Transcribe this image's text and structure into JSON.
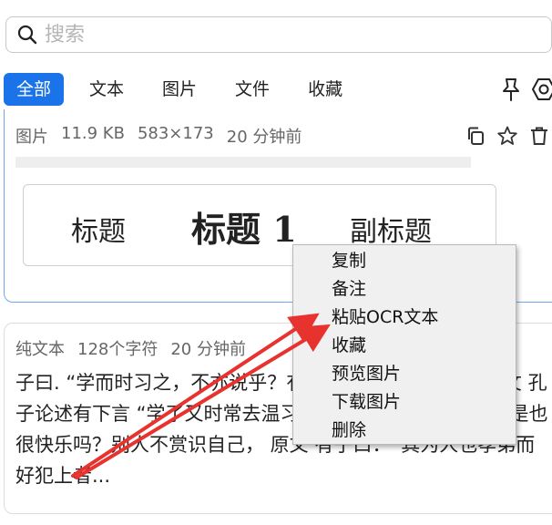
{
  "search": {
    "placeholder": "搜索"
  },
  "tabs": [
    {
      "label": "全部",
      "active": true
    },
    {
      "label": "文本"
    },
    {
      "label": "图片"
    },
    {
      "label": "文件"
    },
    {
      "label": "收藏"
    }
  ],
  "cards": [
    {
      "type": "图片",
      "size": "11.9 KB",
      "dimensions": "583×173",
      "time": "20 分钟前",
      "preview": {
        "text1": "标题",
        "text2": "标题 1",
        "text3": "副标题"
      }
    },
    {
      "type": "纯文本",
      "length": "128个字符",
      "time": "20 分钟前",
      "text": "子曰. “学而时习之，不亦说乎？有朋自远方来，不亦乐 译文 孔子论述有下言 “学了又时常去温习它，远道而来探访友，不是也很快乐吗？别人不赏识自己， 原文 有子曰：“其为人也孝弟而好犯上者..."
    }
  ],
  "context_menu": {
    "items": [
      "复制",
      "备注",
      "粘贴OCR文本",
      "收藏",
      "预览图片",
      "下载图片",
      "删除"
    ]
  },
  "colors": {
    "accent": "#1a73e8",
    "arrow": "#e8322e"
  }
}
